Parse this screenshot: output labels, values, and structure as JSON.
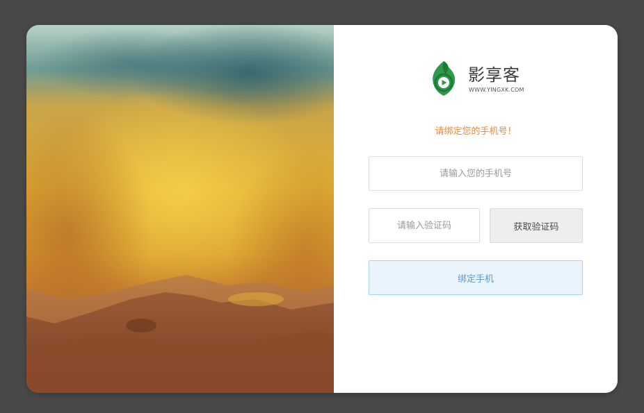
{
  "brand": {
    "name": "影享客",
    "url": "WWW.YINGXK.COM",
    "logo_icon": "play-leaf-logo-icon",
    "colors": {
      "green": "#2e9b4a",
      "dark_green": "#1f7a35",
      "text": "#3a3a3a"
    }
  },
  "hero": {
    "image": "mountain-landscape-illustration",
    "colors": {
      "sky_teal": "#6f9c95",
      "cloud_gold": "#e2b035",
      "ground_brown": "#8b4b2c"
    }
  },
  "form": {
    "prompt": "请绑定您的手机号！",
    "phone_placeholder": "请输入您的手机号",
    "phone_value": "",
    "code_placeholder": "请输入验证码",
    "code_value": "",
    "get_code_label": "获取验证码",
    "submit_label": "绑定手机"
  },
  "colors": {
    "backdrop": "#4a4949",
    "prompt": "#e58a3f",
    "submit_bg": "#eaf4fd",
    "submit_border": "#a6cff0",
    "submit_text": "#5f9ad0",
    "code_button_bg": "#eeeeee"
  }
}
